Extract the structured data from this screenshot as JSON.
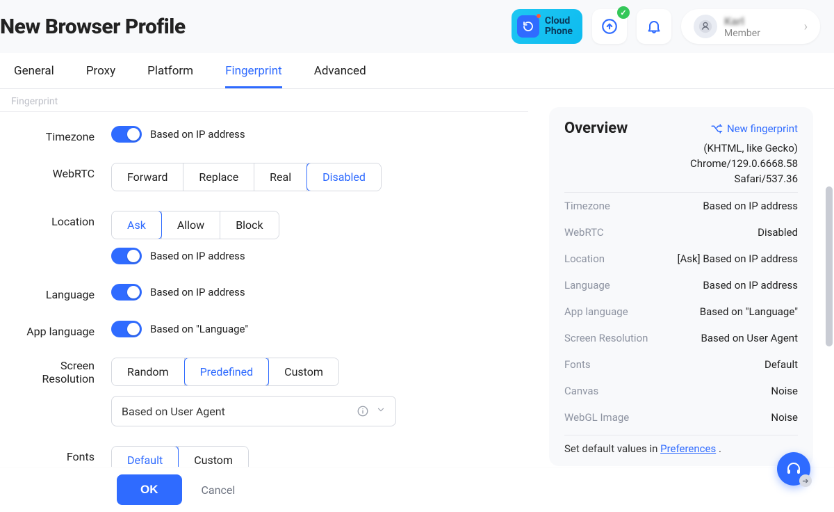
{
  "header": {
    "title": "New Browser Profile",
    "cloud_phone_line1": "Cloud",
    "cloud_phone_line2": "Phone",
    "account_name": "Karl",
    "account_role": "Member"
  },
  "tabs": {
    "general": "General",
    "proxy": "Proxy",
    "platform": "Platform",
    "fingerprint": "Fingerprint",
    "advanced": "Advanced"
  },
  "subheader": "Fingerprint",
  "form": {
    "timezone": {
      "label": "Timezone",
      "toggle_text": "Based on IP address"
    },
    "webrtc": {
      "label": "WebRTC",
      "options": {
        "forward": "Forward",
        "replace": "Replace",
        "real": "Real",
        "disabled": "Disabled"
      }
    },
    "location": {
      "label": "Location",
      "options": {
        "ask": "Ask",
        "allow": "Allow",
        "block": "Block"
      },
      "toggle_text": "Based on IP address"
    },
    "language": {
      "label": "Language",
      "toggle_text": "Based on IP address"
    },
    "app_language": {
      "label": "App language",
      "toggle_text": "Based on \"Language\""
    },
    "screen_res": {
      "label_line1": "Screen",
      "label_line2": "Resolution",
      "options": {
        "random": "Random",
        "predefined": "Predefined",
        "custom": "Custom"
      },
      "select_value": "Based on User Agent"
    },
    "fonts": {
      "label": "Fonts",
      "options": {
        "default": "Default",
        "custom": "Custom"
      }
    }
  },
  "actions": {
    "ok": "OK",
    "cancel": "Cancel"
  },
  "overview": {
    "title": "Overview",
    "new_fp": "New fingerprint",
    "ua_line1": "(KHTML, like Gecko)",
    "ua_line2": "Chrome/129.0.6668.58",
    "ua_line3": "Safari/537.36",
    "rows": {
      "timezone": {
        "k": "Timezone",
        "v": "Based on IP address"
      },
      "webrtc": {
        "k": "WebRTC",
        "v": "Disabled"
      },
      "location": {
        "k": "Location",
        "v": "[Ask] Based on IP address"
      },
      "language": {
        "k": "Language",
        "v": "Based on IP address"
      },
      "app_language": {
        "k": "App language",
        "v": "Based on \"Language\""
      },
      "screen_res": {
        "k": "Screen Resolution",
        "v": "Based on User Agent"
      },
      "fonts": {
        "k": "Fonts",
        "v": "Default"
      },
      "canvas": {
        "k": "Canvas",
        "v": "Noise"
      },
      "webgl": {
        "k": "WebGL Image",
        "v": "Noise"
      }
    },
    "note_prefix": "Set default values in ",
    "note_link": "Preferences",
    "note_suffix": " ."
  }
}
